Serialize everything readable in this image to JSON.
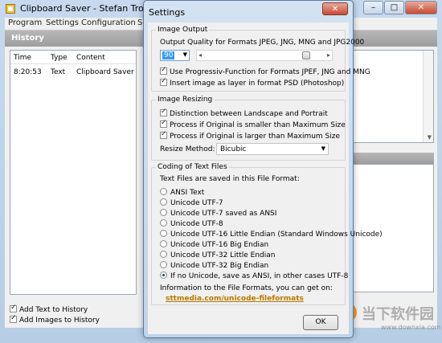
{
  "main_window": {
    "title": "Clipboard Saver - Stefan Trost Media",
    "controls": {
      "minimize": "–",
      "maximize": "□",
      "close": "✕"
    },
    "menu": [
      "Program",
      "Settings",
      "Configuration",
      "So"
    ],
    "history": {
      "title": "History",
      "columns": [
        "Time",
        "Type",
        "Content"
      ],
      "rows": [
        {
          "time": "8:20:53",
          "type": "Text",
          "content": "Clipboard Saver"
        }
      ]
    },
    "options": [
      {
        "label": "Add Text to History",
        "checked": true
      },
      {
        "label": "Add Images to History",
        "checked": true
      }
    ]
  },
  "dialog": {
    "title": "Settings",
    "close": "✕",
    "image_output": {
      "title": "Image Output",
      "quality_label": "Output Quality for Formats JPEG, JNG, MNG and JPG2000",
      "quality_value": "90",
      "quality_level": 0.9,
      "options": [
        {
          "label": "Use Progressiv-Function for Formats JPEF, JNG and MNG",
          "checked": true
        },
        {
          "label": "Insert image as layer in format PSD (Photoshop)",
          "checked": true
        }
      ]
    },
    "image_resizing": {
      "title": "Image Resizing",
      "options": [
        {
          "label": "Distinction between Landscape and Portrait",
          "checked": true
        },
        {
          "label": "Process if Original is smaller than Maximum Size",
          "checked": true
        },
        {
          "label": "Process if Original is larger than Maximum Size",
          "checked": true
        }
      ],
      "method_label": "Resize Method:",
      "method_value": "Bicubic"
    },
    "text_coding": {
      "title": "Coding of Text Files",
      "intro": "Text Files are saved in this File Format:",
      "options": [
        "ANSI Text",
        "Unicode UTF-7",
        "Unicode UTF-7 saved as ANSI",
        "Unicode UTF-8",
        "Unicode UTF-16 Little Endian (Standard Windows Unicode)",
        "Unicode UTF-16 Big Endian",
        "Unicode UTF-32 Little Endian",
        "Unicode UTF-32 Big Endian",
        "If no Unicode, save as ANSI, in other cases UTF-8"
      ],
      "selected_index": 8,
      "info": "Information to the File Formats, you can get on:",
      "link": "sttmedia.com/unicode-fileformats"
    },
    "ok_label": "OK"
  },
  "watermark": {
    "name": "当下软件园",
    "url": "www.downxia.com"
  }
}
